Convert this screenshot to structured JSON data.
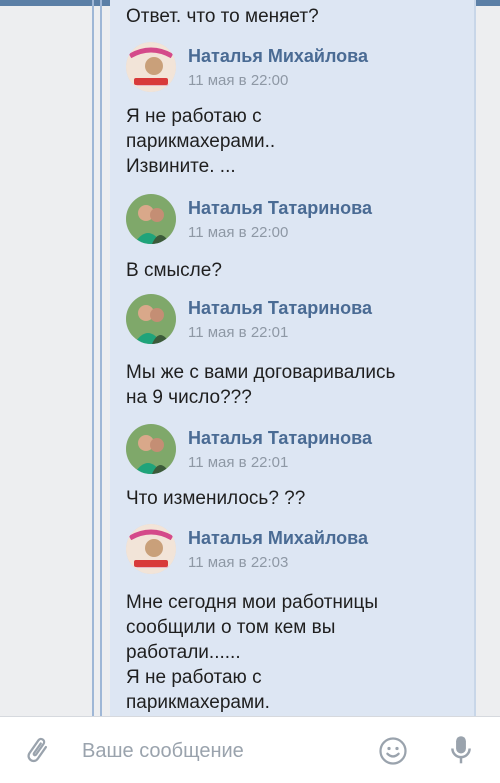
{
  "conversation": {
    "top_text": "Ответ.  что то меняет?",
    "messages": [
      {
        "sender": "Наталья Михайлова",
        "time": "11 мая в 22:00",
        "avatar": "avatar-mikhailova",
        "lines": [
          "Я не работаю с",
          "парикмахерами..",
          "Извините. ..."
        ]
      },
      {
        "sender": "Наталья Татаринова",
        "time": "11 мая в 22:00",
        "avatar": "avatar-tatarinova",
        "lines": [
          "В смысле?"
        ]
      },
      {
        "sender": "Наталья Татаринова",
        "time": "11 мая в 22:01",
        "avatar": "avatar-tatarinova",
        "lines": [
          "Мы же с вами договаривались",
          "на 9 число???"
        ]
      },
      {
        "sender": "Наталья Татаринова",
        "time": "11 мая в 22:01",
        "avatar": "avatar-tatarinova",
        "lines": [
          "Что изменилось? ??"
        ]
      },
      {
        "sender": "Наталья Михайлова",
        "time": "11 мая в 22:03",
        "avatar": "avatar-mikhailova",
        "lines": [
          "Мне сегодня мои работницы",
          "сообщили о том кем вы",
          "работали......",
          "Я не работаю с",
          "парикмахерами."
        ]
      }
    ]
  },
  "composer": {
    "placeholder": "Ваше сообщение",
    "attach_icon": "paperclip-icon",
    "emoji_icon": "smiley-icon",
    "voice_icon": "microphone-icon"
  },
  "colors": {
    "panel_bg": "#dde6f3",
    "name_color": "#4a6b94",
    "time_color": "#8e98a5",
    "header_blue": "#5b7fa6"
  }
}
